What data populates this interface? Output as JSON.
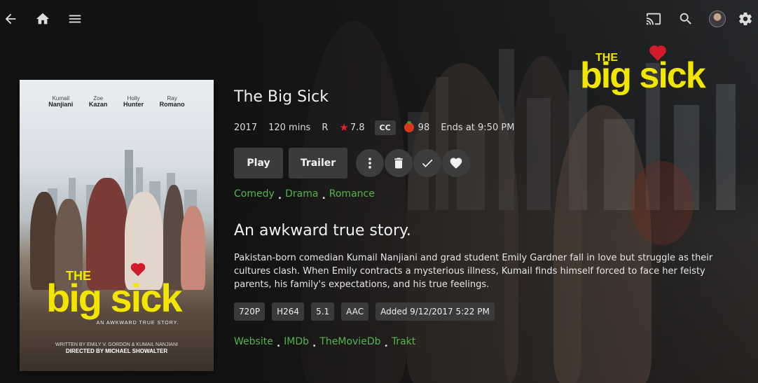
{
  "topbar": {
    "back_icon": "arrow-left-icon",
    "home_icon": "home-icon",
    "menu_icon": "hamburger-menu-icon",
    "cast_icon": "cast-icon",
    "search_icon": "search-icon",
    "settings_icon": "gear-icon"
  },
  "logo": {
    "the": "THE",
    "main": "big sick"
  },
  "poster": {
    "cast": [
      {
        "first": "Kumail",
        "last": "Nanjiani"
      },
      {
        "first": "Zoe",
        "last": "Kazan"
      },
      {
        "first": "Holly",
        "last": "Hunter"
      },
      {
        "first": "Ray",
        "last": "Romano"
      }
    ],
    "the": "THE",
    "title": "big sick",
    "tagline": "AN AWKWARD TRUE STORY.",
    "credits_line1": "WRITTEN BY EMILY V. GORDON & KUMAIL NANJIANI",
    "credits_line2": "DIRECTED BY MICHAEL SHOWALTER"
  },
  "movie": {
    "title": "The Big Sick",
    "year": "2017",
    "runtime": "120 mins",
    "rating": "R",
    "community_rating": "7.8",
    "cc": "CC",
    "critic_rating": "98",
    "ends_at": "Ends at 9:50 PM",
    "genres": [
      "Comedy",
      "Drama",
      "Romance"
    ],
    "tagline": "An awkward true story.",
    "overview": "Pakistan-born comedian Kumail Nanjiani and grad student Emily Gardner fall in love but struggle as their cultures clash. When Emily contracts a mysterious illness, Kumail finds himself forced to face her feisty parents, his family's expectations, and his true feelings.",
    "media_info": [
      "720P",
      "H264",
      "5.1",
      "AAC",
      "Added 9/12/2017 5:22 PM"
    ],
    "external_links": [
      "Website",
      "IMDb",
      "TheMovieDb",
      "Trakt"
    ]
  },
  "actions": {
    "play_label": "Play",
    "trailer_label": "Trailer"
  },
  "colors": {
    "accent": "#52b54b",
    "logo_yellow": "#f2e600",
    "star": "#e2212f",
    "button_bg": "#3b3b3b"
  }
}
